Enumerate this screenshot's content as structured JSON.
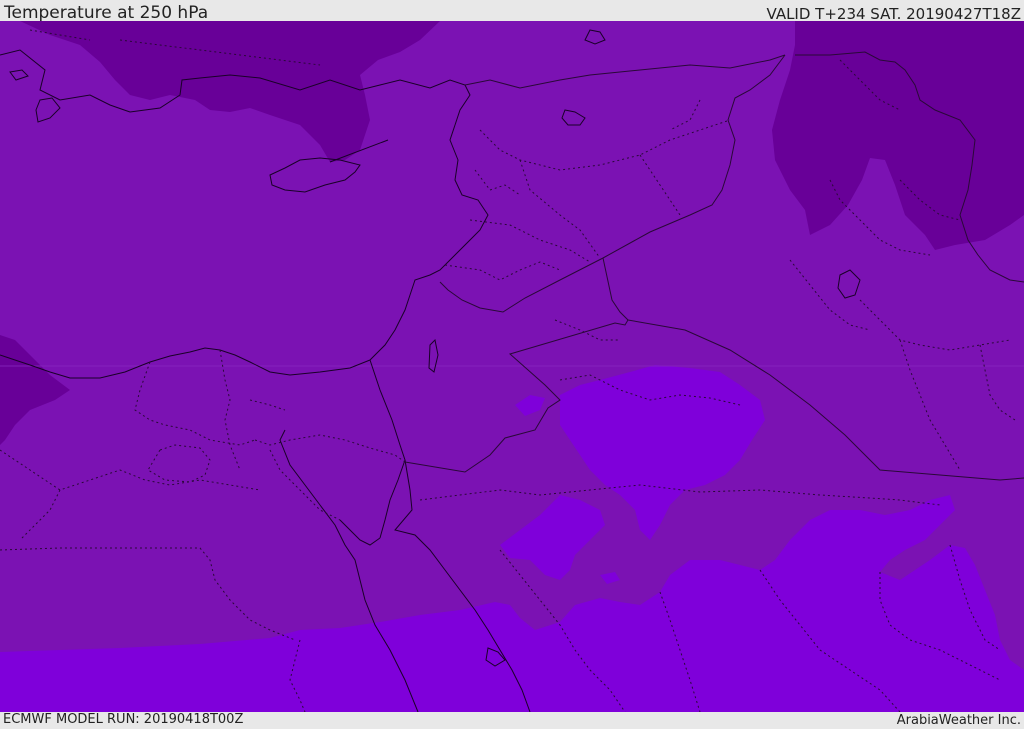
{
  "header": {
    "title": "Temperature at 250 hPa",
    "valid": "VALID T+234 SAT. 20190427T18Z"
  },
  "footer": {
    "model_run": "ECMWF MODEL RUN: 20190418T00Z",
    "credit": "ArabiaWeather Inc."
  },
  "colors": {
    "base": "#7b12b3",
    "cold": "#680098",
    "warm": "#7f00da",
    "coastline": "#1a0028",
    "border": "#2a0838"
  }
}
